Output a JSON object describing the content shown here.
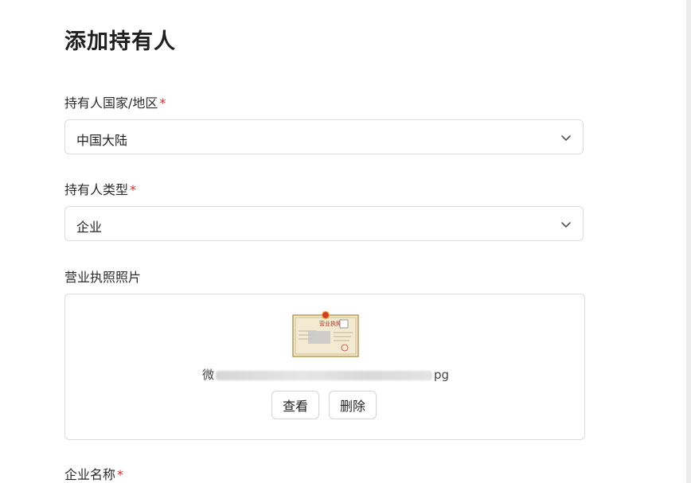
{
  "page": {
    "title": "添加持有人"
  },
  "fields": {
    "country": {
      "label": "持有人国家/地区",
      "required_mark": "*",
      "value": "中国大陆"
    },
    "holder_type": {
      "label": "持有人类型",
      "required_mark": "*",
      "value": "企业"
    },
    "license": {
      "label": "营业执照照片",
      "file_name_start": "微",
      "file_name_end": "pg",
      "view_label": "查看",
      "delete_label": "删除",
      "thumbnail_header": "营业执照"
    },
    "company_name": {
      "label": "企业名称",
      "required_mark": "*"
    }
  },
  "colors": {
    "required": "#e0282e",
    "border": "#dcdcdc",
    "text": "#222222"
  }
}
